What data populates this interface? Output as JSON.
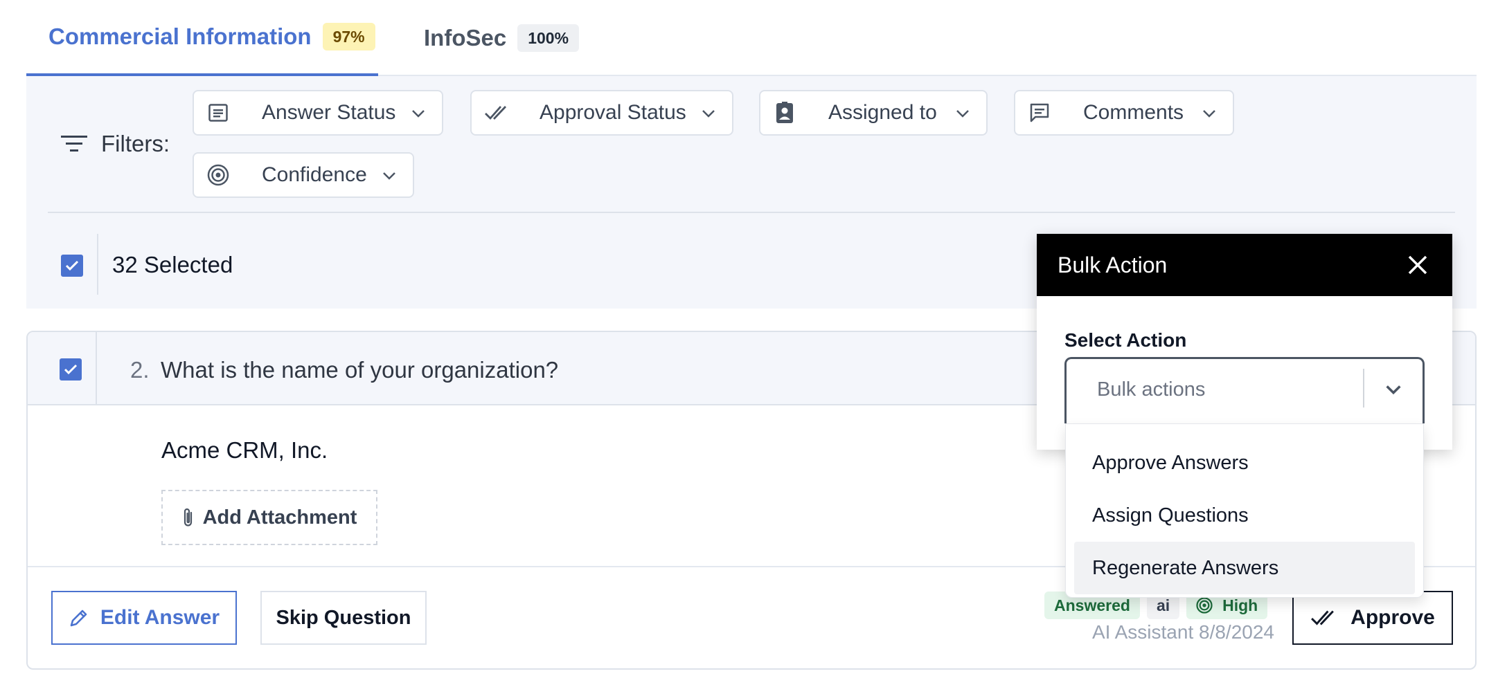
{
  "tabs": [
    {
      "label": "Commercial Information",
      "badge": "97%"
    },
    {
      "label": "InfoSec",
      "badge": "100%"
    }
  ],
  "filters": {
    "label": "Filters:",
    "items": [
      {
        "label": "Answer Status",
        "icon": "list-icon"
      },
      {
        "label": "Approval Status",
        "icon": "double-check-icon"
      },
      {
        "label": "Assigned to",
        "icon": "id-badge-icon"
      },
      {
        "label": "Comments",
        "icon": "comment-icon"
      },
      {
        "label": "Confidence",
        "icon": "target-icon"
      }
    ]
  },
  "selection": {
    "count_label": "32 Selected",
    "checked": true
  },
  "question": {
    "number": "2.",
    "text": "What is the name of your organization?",
    "answer": "Acme CRM, Inc.",
    "add_attachment": "Add Attachment",
    "edit_answer": "Edit Answer",
    "skip_question": "Skip Question",
    "status_tags": {
      "answered": "Answered",
      "ai": "ai",
      "confidence": "High"
    },
    "author": "AI Assistant 8/8/2024",
    "approve": "Approve"
  },
  "bulk_action": {
    "title": "Bulk Action",
    "select_label": "Select Action",
    "placeholder": "Bulk actions",
    "options": [
      "Approve Answers",
      "Assign Questions",
      "Regenerate Answers"
    ],
    "highlighted_option": "Regenerate Answers"
  },
  "colors": {
    "accent": "#4a72cf",
    "panel_bg": "#f4f6fb",
    "badge_yellow": "#fdf3b5",
    "tag_green_bg": "#e4f5ea",
    "tag_green_text": "#1d6b3b"
  }
}
